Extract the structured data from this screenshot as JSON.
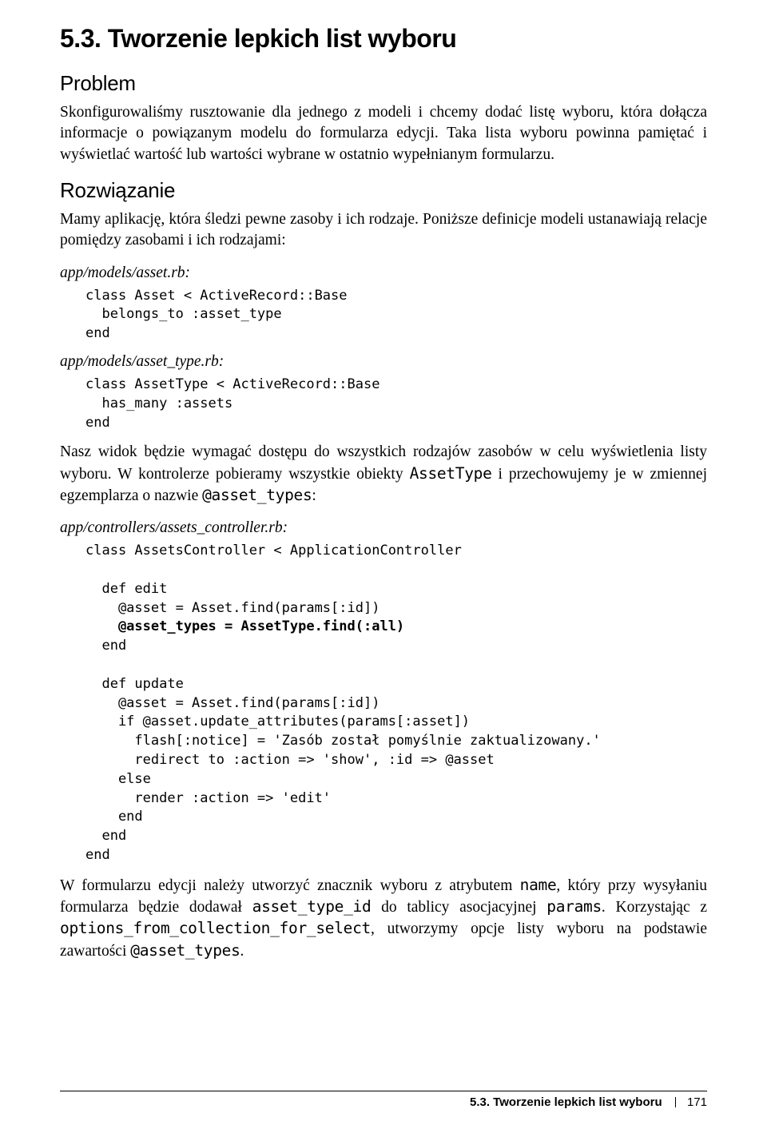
{
  "section_number_title": "5.3. Tworzenie lepkich list wyboru",
  "problem_heading": "Problem",
  "problem_text": "Skonfigurowaliśmy rusztowanie dla jednego z modeli i chcemy dodać listę wyboru, która dołącza informacje o powiązanym modelu do formularza edycji. Taka lista wyboru powinna pamiętać i wyświetlać wartość lub wartości wybrane w ostatnio wypełnianym formularzu.",
  "solution_heading": "Rozwiązanie",
  "solution_intro": "Mamy aplikację, która śledzi pewne zasoby i ich rodzaje. Poniższe definicje modeli ustanawiają relacje pomiędzy zasobami i ich rodzajami:",
  "file1_path": "app/models/asset.rb:",
  "file1_code": "class Asset < ActiveRecord::Base\n  belongs_to :asset_type\nend",
  "file2_path": "app/models/asset_type.rb:",
  "file2_code": "class AssetType < ActiveRecord::Base\n  has_many :assets\nend",
  "para2_pre": "Nasz widok będzie wymagać dostępu do wszystkich rodzajów zasobów w celu wyświetlenia listy wyboru. W kontrolerze pobieramy wszystkie obiekty ",
  "para2_code1": "AssetType",
  "para2_mid": " i przechowujemy je w zmiennej egzemplarza o nazwie ",
  "para2_code2": "@asset_types",
  "para2_post": ":",
  "file3_path": "app/controllers/assets_controller.rb:",
  "file3_code_a": "class AssetsController < ApplicationController\n\n  def edit\n    @asset = Asset.find(params[:id])",
  "file3_code_bold": "    @asset_types = AssetType.find(:all)",
  "file3_code_b": "  end\n\n  def update\n    @asset = Asset.find(params[:id])\n    if @asset.update_attributes(params[:asset])\n      flash[:notice] = 'Zasób został pomyślnie zaktualizowany.'\n      redirect to :action => 'show', :id => @asset\n    else\n      render :action => 'edit'\n    end\n  end\nend",
  "para3_pre": "W formularzu edycji należy utworzyć znacznik wyboru z atrybutem ",
  "para3_c1": "name",
  "para3_s1": ", który przy wysyłaniu formularza będzie dodawał ",
  "para3_c2": "asset_type_id",
  "para3_s2": " do tablicy asocjacyjnej ",
  "para3_c3": "params",
  "para3_s3": ". Korzystając z ",
  "para3_c4": "options_from_collection_for_select",
  "para3_s4": ", utworzymy opcje listy wyboru na podstawie zawartości ",
  "para3_c5": "@asset_types",
  "para3_s5": ".",
  "footer_title": "5.3. Tworzenie lepkich list wyboru",
  "footer_page": "171"
}
